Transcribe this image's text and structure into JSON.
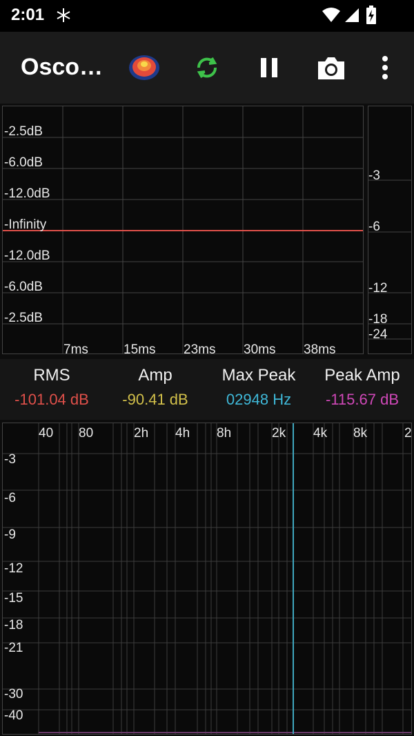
{
  "status_bar": {
    "time": "2:01"
  },
  "app_bar": {
    "title": "Osco…",
    "icons": [
      "spectrum-app-icon",
      "sync-icon",
      "pause-icon",
      "camera-icon",
      "more-vert-icon"
    ]
  },
  "waveform": {
    "y_labels": [
      "-2.5dB",
      "-6.0dB",
      "-12.0dB",
      "-Infinity",
      "-12.0dB",
      "-6.0dB",
      "-2.5dB"
    ],
    "x_labels": [
      "7ms",
      "15ms",
      "23ms",
      "30ms",
      "38ms"
    ],
    "signal_level": "-Infinity",
    "line_color": "#e0504a"
  },
  "level_meter": {
    "labels": [
      "-3",
      "-6",
      "-12",
      "-18",
      "-24"
    ]
  },
  "stats": [
    {
      "label": "RMS",
      "value": "-101.04 dB",
      "color": "#e0504a"
    },
    {
      "label": "Amp",
      "value": "-90.41 dB",
      "color": "#d2c04a"
    },
    {
      "label": "Max Peak",
      "value": "02948 Hz",
      "color": "#3fb8d8"
    },
    {
      "label": "Peak Amp",
      "value": "-115.67 dB",
      "color": "#d048b8"
    }
  ],
  "spectrum": {
    "x_labels": [
      "40",
      "80",
      "2h",
      "4h",
      "8h",
      "2k",
      "4k",
      "8k",
      "2"
    ],
    "y_labels": [
      "-3",
      "-6",
      "-9",
      "-12",
      "-15",
      "-18",
      "-21",
      "-30",
      "-40"
    ],
    "peak_marker_color": "#3fa8c0"
  }
}
